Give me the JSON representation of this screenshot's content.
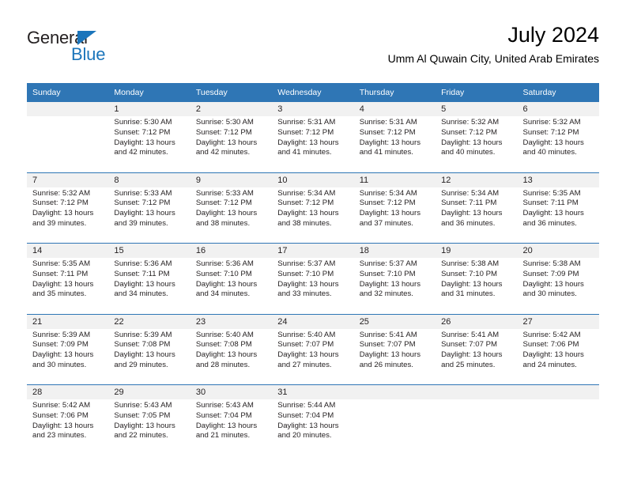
{
  "logo": {
    "word_one": "General",
    "word_two": "Blue",
    "triangle_icon": "triangle-right-icon",
    "brand_color": "#1b75bb"
  },
  "header": {
    "title": "July 2024",
    "subtitle": "Umm Al Quwain City, United Arab Emirates"
  },
  "colors": {
    "header_blue": "#2f76b5",
    "daynum_band": "#f1f1f1",
    "text": "#231f20"
  },
  "labels": {
    "sunrise_prefix": "Sunrise:",
    "sunset_prefix": "Sunset:",
    "daylight_prefix": "Daylight:"
  },
  "weekdays": [
    "Sunday",
    "Monday",
    "Tuesday",
    "Wednesday",
    "Thursday",
    "Friday",
    "Saturday"
  ],
  "weeks": [
    {
      "days": [
        {
          "day": "",
          "sunrise": "",
          "sunset": "",
          "daylight_a": "",
          "daylight_b": ""
        },
        {
          "day": "1",
          "sunrise": "Sunrise: 5:30 AM",
          "sunset": "Sunset: 7:12 PM",
          "daylight_a": "Daylight: 13 hours",
          "daylight_b": "and 42 minutes."
        },
        {
          "day": "2",
          "sunrise": "Sunrise: 5:30 AM",
          "sunset": "Sunset: 7:12 PM",
          "daylight_a": "Daylight: 13 hours",
          "daylight_b": "and 42 minutes."
        },
        {
          "day": "3",
          "sunrise": "Sunrise: 5:31 AM",
          "sunset": "Sunset: 7:12 PM",
          "daylight_a": "Daylight: 13 hours",
          "daylight_b": "and 41 minutes."
        },
        {
          "day": "4",
          "sunrise": "Sunrise: 5:31 AM",
          "sunset": "Sunset: 7:12 PM",
          "daylight_a": "Daylight: 13 hours",
          "daylight_b": "and 41 minutes."
        },
        {
          "day": "5",
          "sunrise": "Sunrise: 5:32 AM",
          "sunset": "Sunset: 7:12 PM",
          "daylight_a": "Daylight: 13 hours",
          "daylight_b": "and 40 minutes."
        },
        {
          "day": "6",
          "sunrise": "Sunrise: 5:32 AM",
          "sunset": "Sunset: 7:12 PM",
          "daylight_a": "Daylight: 13 hours",
          "daylight_b": "and 40 minutes."
        }
      ]
    },
    {
      "days": [
        {
          "day": "7",
          "sunrise": "Sunrise: 5:32 AM",
          "sunset": "Sunset: 7:12 PM",
          "daylight_a": "Daylight: 13 hours",
          "daylight_b": "and 39 minutes."
        },
        {
          "day": "8",
          "sunrise": "Sunrise: 5:33 AM",
          "sunset": "Sunset: 7:12 PM",
          "daylight_a": "Daylight: 13 hours",
          "daylight_b": "and 39 minutes."
        },
        {
          "day": "9",
          "sunrise": "Sunrise: 5:33 AM",
          "sunset": "Sunset: 7:12 PM",
          "daylight_a": "Daylight: 13 hours",
          "daylight_b": "and 38 minutes."
        },
        {
          "day": "10",
          "sunrise": "Sunrise: 5:34 AM",
          "sunset": "Sunset: 7:12 PM",
          "daylight_a": "Daylight: 13 hours",
          "daylight_b": "and 38 minutes."
        },
        {
          "day": "11",
          "sunrise": "Sunrise: 5:34 AM",
          "sunset": "Sunset: 7:12 PM",
          "daylight_a": "Daylight: 13 hours",
          "daylight_b": "and 37 minutes."
        },
        {
          "day": "12",
          "sunrise": "Sunrise: 5:34 AM",
          "sunset": "Sunset: 7:11 PM",
          "daylight_a": "Daylight: 13 hours",
          "daylight_b": "and 36 minutes."
        },
        {
          "day": "13",
          "sunrise": "Sunrise: 5:35 AM",
          "sunset": "Sunset: 7:11 PM",
          "daylight_a": "Daylight: 13 hours",
          "daylight_b": "and 36 minutes."
        }
      ]
    },
    {
      "days": [
        {
          "day": "14",
          "sunrise": "Sunrise: 5:35 AM",
          "sunset": "Sunset: 7:11 PM",
          "daylight_a": "Daylight: 13 hours",
          "daylight_b": "and 35 minutes."
        },
        {
          "day": "15",
          "sunrise": "Sunrise: 5:36 AM",
          "sunset": "Sunset: 7:11 PM",
          "daylight_a": "Daylight: 13 hours",
          "daylight_b": "and 34 minutes."
        },
        {
          "day": "16",
          "sunrise": "Sunrise: 5:36 AM",
          "sunset": "Sunset: 7:10 PM",
          "daylight_a": "Daylight: 13 hours",
          "daylight_b": "and 34 minutes."
        },
        {
          "day": "17",
          "sunrise": "Sunrise: 5:37 AM",
          "sunset": "Sunset: 7:10 PM",
          "daylight_a": "Daylight: 13 hours",
          "daylight_b": "and 33 minutes."
        },
        {
          "day": "18",
          "sunrise": "Sunrise: 5:37 AM",
          "sunset": "Sunset: 7:10 PM",
          "daylight_a": "Daylight: 13 hours",
          "daylight_b": "and 32 minutes."
        },
        {
          "day": "19",
          "sunrise": "Sunrise: 5:38 AM",
          "sunset": "Sunset: 7:10 PM",
          "daylight_a": "Daylight: 13 hours",
          "daylight_b": "and 31 minutes."
        },
        {
          "day": "20",
          "sunrise": "Sunrise: 5:38 AM",
          "sunset": "Sunset: 7:09 PM",
          "daylight_a": "Daylight: 13 hours",
          "daylight_b": "and 30 minutes."
        }
      ]
    },
    {
      "days": [
        {
          "day": "21",
          "sunrise": "Sunrise: 5:39 AM",
          "sunset": "Sunset: 7:09 PM",
          "daylight_a": "Daylight: 13 hours",
          "daylight_b": "and 30 minutes."
        },
        {
          "day": "22",
          "sunrise": "Sunrise: 5:39 AM",
          "sunset": "Sunset: 7:08 PM",
          "daylight_a": "Daylight: 13 hours",
          "daylight_b": "and 29 minutes."
        },
        {
          "day": "23",
          "sunrise": "Sunrise: 5:40 AM",
          "sunset": "Sunset: 7:08 PM",
          "daylight_a": "Daylight: 13 hours",
          "daylight_b": "and 28 minutes."
        },
        {
          "day": "24",
          "sunrise": "Sunrise: 5:40 AM",
          "sunset": "Sunset: 7:07 PM",
          "daylight_a": "Daylight: 13 hours",
          "daylight_b": "and 27 minutes."
        },
        {
          "day": "25",
          "sunrise": "Sunrise: 5:41 AM",
          "sunset": "Sunset: 7:07 PM",
          "daylight_a": "Daylight: 13 hours",
          "daylight_b": "and 26 minutes."
        },
        {
          "day": "26",
          "sunrise": "Sunrise: 5:41 AM",
          "sunset": "Sunset: 7:07 PM",
          "daylight_a": "Daylight: 13 hours",
          "daylight_b": "and 25 minutes."
        },
        {
          "day": "27",
          "sunrise": "Sunrise: 5:42 AM",
          "sunset": "Sunset: 7:06 PM",
          "daylight_a": "Daylight: 13 hours",
          "daylight_b": "and 24 minutes."
        }
      ]
    },
    {
      "days": [
        {
          "day": "28",
          "sunrise": "Sunrise: 5:42 AM",
          "sunset": "Sunset: 7:06 PM",
          "daylight_a": "Daylight: 13 hours",
          "daylight_b": "and 23 minutes."
        },
        {
          "day": "29",
          "sunrise": "Sunrise: 5:43 AM",
          "sunset": "Sunset: 7:05 PM",
          "daylight_a": "Daylight: 13 hours",
          "daylight_b": "and 22 minutes."
        },
        {
          "day": "30",
          "sunrise": "Sunrise: 5:43 AM",
          "sunset": "Sunset: 7:04 PM",
          "daylight_a": "Daylight: 13 hours",
          "daylight_b": "and 21 minutes."
        },
        {
          "day": "31",
          "sunrise": "Sunrise: 5:44 AM",
          "sunset": "Sunset: 7:04 PM",
          "daylight_a": "Daylight: 13 hours",
          "daylight_b": "and 20 minutes."
        },
        {
          "day": "",
          "sunrise": "",
          "sunset": "",
          "daylight_a": "",
          "daylight_b": ""
        },
        {
          "day": "",
          "sunrise": "",
          "sunset": "",
          "daylight_a": "",
          "daylight_b": ""
        },
        {
          "day": "",
          "sunrise": "",
          "sunset": "",
          "daylight_a": "",
          "daylight_b": ""
        }
      ]
    }
  ]
}
